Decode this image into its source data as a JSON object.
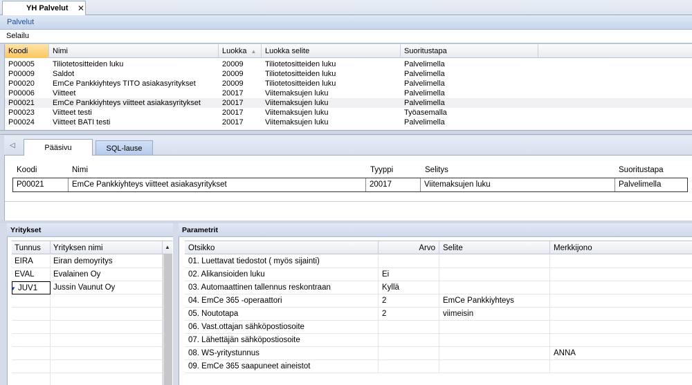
{
  "document_tab": {
    "title": "YH Palvelut",
    "close_glyph": "✕"
  },
  "section_title": "Palvelut",
  "mode_label": "Selailu",
  "services_grid": {
    "headers": [
      "Koodi",
      "Nimi",
      "Luokka",
      "Luokka selite",
      "Suoritustapa"
    ],
    "sort_column": "Luokka",
    "rows": [
      [
        "P00005",
        "Tiliotetositteiden luku",
        "20009",
        "Tiliotetositteiden luku",
        "Palvelimella"
      ],
      [
        "P00009",
        "Saldot",
        "20009",
        "Tiliotetositteiden luku",
        "Palvelimella"
      ],
      [
        "P00020",
        "EmCe Pankkiyhteys TITO asiakasyritykset",
        "20009",
        "Tiliotetositteiden luku",
        "Palvelimella"
      ],
      [
        "P00006",
        "Viitteet",
        "20017",
        "Viitemaksujen luku",
        "Palvelimella"
      ],
      [
        "P00021",
        "EmCe Pankkiyhteys viitteet asiakasyritykset",
        "20017",
        "Viitemaksujen luku",
        "Palvelimella"
      ],
      [
        "P00023",
        "Viitteet testi",
        "20017",
        "Viitemaksujen luku",
        "Työasemalla"
      ],
      [
        "P00024",
        "Viitteet BATI testi",
        "20017",
        "Viitemaksujen luku",
        "Palvelimella"
      ]
    ],
    "selected_row": 4
  },
  "page_tabs": {
    "main": "Pääsivu",
    "sql": "SQL-lause"
  },
  "detail": {
    "labels": {
      "code": "Koodi",
      "name": "Nimi",
      "type": "Tyyppi",
      "desc": "Selitys",
      "exec": "Suoritustapa"
    },
    "values": {
      "code": "P00021",
      "name": "EmCe Pankkiyhteys viitteet asiakasyritykset",
      "type": "20017",
      "desc": "Viitemaksujen luku",
      "exec": "Palvelimella"
    }
  },
  "companies": {
    "title": "Yritykset",
    "headers": [
      "Tunnus",
      "Yrityksen nimi"
    ],
    "rows": [
      [
        "EIRA",
        "Eiran demoyritys"
      ],
      [
        "EVAL",
        "Evalainen Oy"
      ],
      [
        "JUV1",
        "Jussin Vaunut Oy"
      ]
    ]
  },
  "parameters": {
    "title": "Parametrit",
    "headers": [
      "Otsikko",
      "Arvo",
      "Selite",
      "Merkkijono"
    ],
    "rows": [
      [
        "01. Luettavat tiedostot ( myös sijainti)",
        "",
        "",
        ""
      ],
      [
        "02. Alikansioiden luku",
        "Ei",
        "",
        ""
      ],
      [
        "03. Automaattinen tallennus reskontraan",
        "Kyllä",
        "",
        ""
      ],
      [
        "04. EmCe 365 -operaattori",
        "2",
        "EmCe Pankkiyhteys",
        ""
      ],
      [
        "05. Noutotapa",
        "2",
        "viimeisin",
        ""
      ],
      [
        "06. Vast.ottajan sähköpostiosoite",
        "",
        "",
        ""
      ],
      [
        "07. Lähettäjän sähköpostiosoite",
        "",
        "",
        ""
      ],
      [
        "08. WS-yritystunnus",
        "",
        "",
        "ANNA"
      ],
      [
        "09. EmCe 365 saapuneet aineistot",
        "",
        "",
        ""
      ]
    ]
  }
}
